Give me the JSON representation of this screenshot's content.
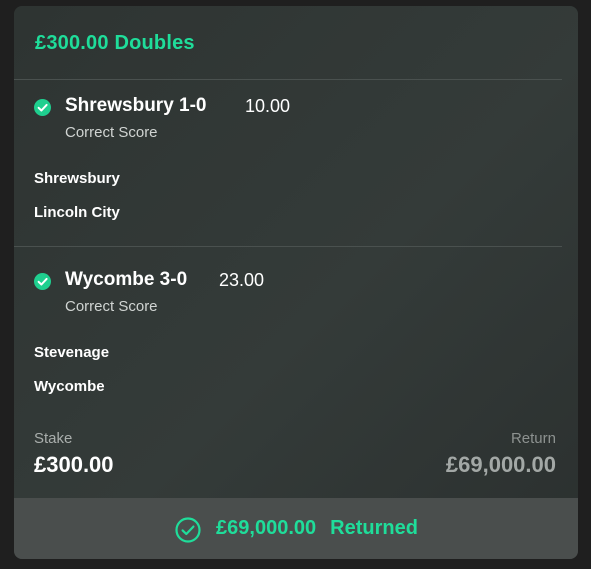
{
  "bet": {
    "title": "£300.00 Doubles"
  },
  "selections": [
    {
      "name": "Shrewsbury 1-0",
      "odds": "10.00",
      "market": "Correct Score",
      "home_team": "Shrewsbury",
      "away_team": "Lincoln City",
      "status_icon": "check-circle-icon"
    },
    {
      "name": "Wycombe 3-0",
      "odds": "23.00",
      "market": "Correct Score",
      "home_team": "Stevenage",
      "away_team": "Wycombe",
      "status_icon": "check-circle-icon"
    }
  ],
  "summary": {
    "stake_label": "Stake",
    "stake_value": "£300.00",
    "return_label": "Return",
    "return_value": "£69,000.00"
  },
  "footer": {
    "amount": "£69,000.00",
    "status": "Returned",
    "icon": "check-circle-outline-icon"
  },
  "colors": {
    "accent": "#1fdd9a",
    "card_background": "#303735",
    "footer_background": "#4a4e4d"
  }
}
